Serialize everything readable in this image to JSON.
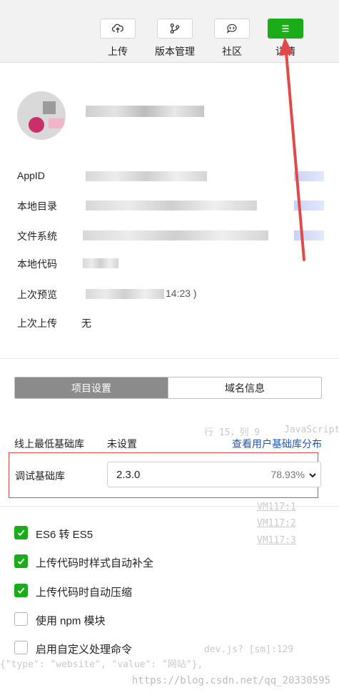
{
  "toolbar": {
    "upload_label": "上传",
    "version_label": "版本管理",
    "community_label": "社区",
    "details_label": "详情"
  },
  "profile": {
    "appid_label": "AppID",
    "appid_value_tail": "",
    "local_dir_label": "本地目录",
    "fs_label": "文件系统",
    "local_code_label": "本地代码",
    "last_preview_label": "上次预览",
    "last_preview_tail": "14:23 )",
    "last_upload_label": "上次上传",
    "last_upload_value": "无"
  },
  "settings": {
    "tab_project": "项目设置",
    "tab_domain": "域名信息",
    "min_lib_label": "线上最低基础库",
    "min_lib_value": "未设置",
    "view_dist_link": "查看用户基础库分布",
    "debug_lib_label": "调试基础库",
    "debug_lib_version": "2.3.0",
    "debug_lib_percent": "78.93%",
    "options": [
      {
        "label": "ES6 转 ES5",
        "checked": true
      },
      {
        "label": "上传代码时样式自动补全",
        "checked": true
      },
      {
        "label": "上传代码时自动压缩",
        "checked": true
      },
      {
        "label": "使用 npm 模块",
        "checked": false
      },
      {
        "label": "启用自定义处理命令",
        "checked": false
      }
    ]
  },
  "ghost_text": {
    "line_info": "行 15，列 9",
    "lang": "JavaScript",
    "vm1": "VM117:1",
    "vm2": "VM117:2",
    "vm3": "VM117:3",
    "devjs": "dev.js? [sm]:129",
    "code": "{\"type\": \"website\", \"value\": \"网站\"},"
  },
  "watermark": "https://blog.csdn.net/qq_20330595",
  "colors": {
    "accent": "#1aad19",
    "link": "#1a56c7",
    "annotation": "#e24a4a"
  }
}
